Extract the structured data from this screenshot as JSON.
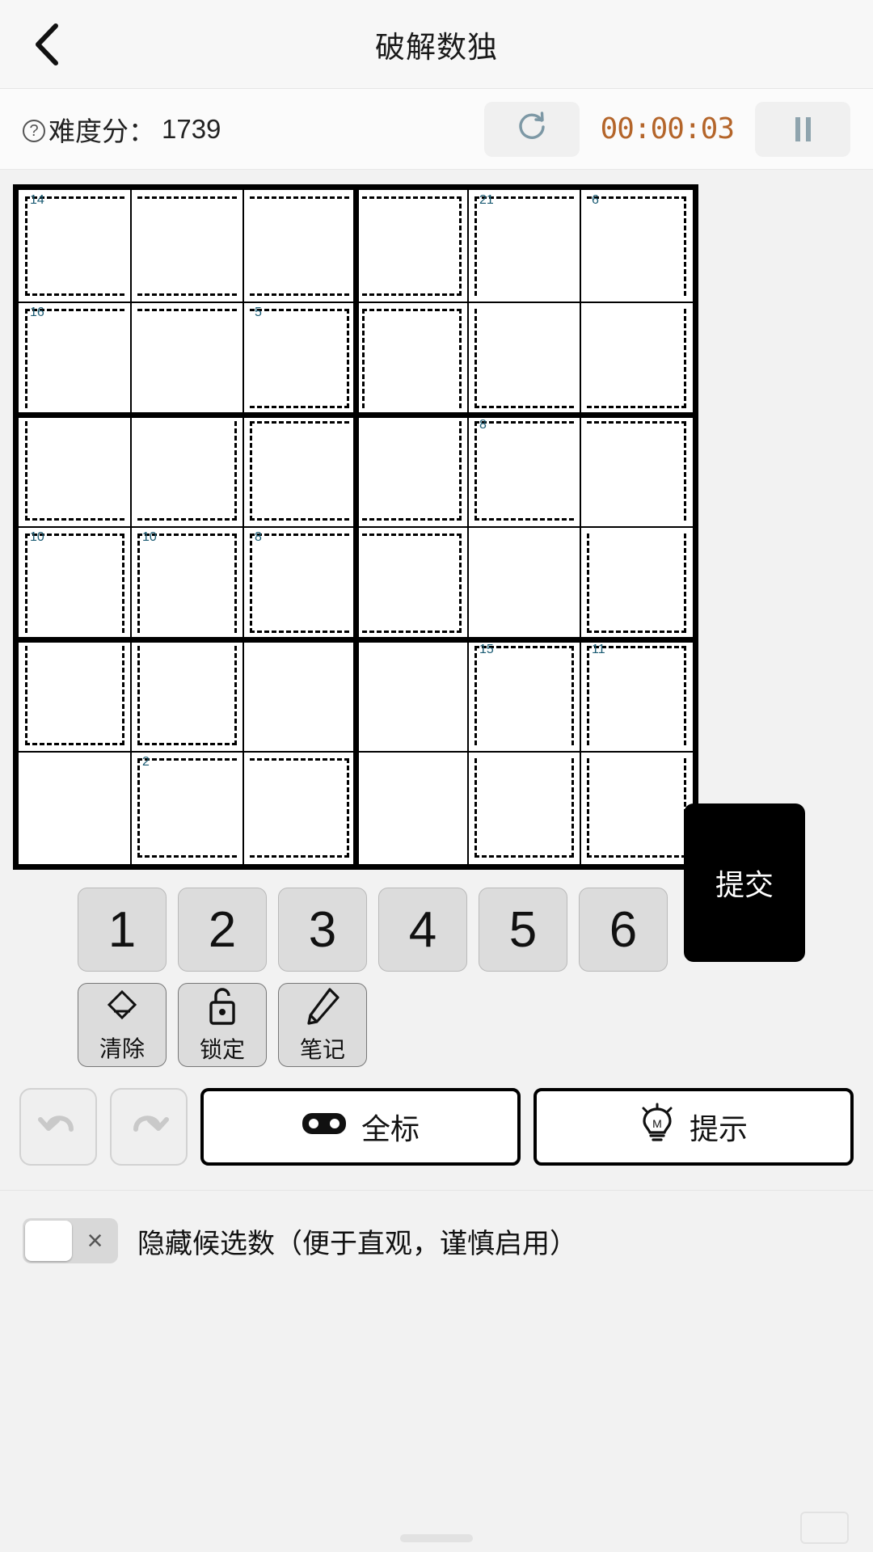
{
  "header": {
    "back_icon": "chevron-left-icon",
    "title": "破解数独"
  },
  "infobar": {
    "help_icon": "question-circle-icon",
    "difficulty_label": "难度分：",
    "difficulty_value": "1739",
    "refresh_icon": "refresh-icon",
    "timer": "00:00:03",
    "pause_icon": "pause-icon",
    "timer_color": "#b4652a"
  },
  "board": {
    "size": 6,
    "box_rows": 2,
    "box_cols": 3,
    "cage_sum_color": "#1a5b73",
    "cages": [
      {
        "sum": "14",
        "cells": [
          [
            0,
            0
          ],
          [
            0,
            1
          ],
          [
            0,
            2
          ],
          [
            0,
            3
          ]
        ]
      },
      {
        "sum": "21",
        "cells": [
          [
            0,
            4
          ],
          [
            0,
            5
          ],
          [
            1,
            5
          ],
          [
            1,
            4
          ]
        ]
      },
      {
        "sum": "6",
        "cells": [
          [
            0,
            5
          ]
        ]
      },
      {
        "sum": "16",
        "cells": [
          [
            1,
            0
          ],
          [
            1,
            1
          ],
          [
            1,
            2
          ],
          [
            2,
            0
          ],
          [
            2,
            1
          ]
        ]
      },
      {
        "sum": "5",
        "cells": [
          [
            1,
            2
          ],
          [
            1,
            3
          ],
          [
            2,
            2
          ],
          [
            2,
            3
          ]
        ]
      },
      {
        "sum": "8",
        "cells": [
          [
            2,
            4
          ],
          [
            2,
            5
          ],
          [
            3,
            5
          ]
        ]
      },
      {
        "sum": "10",
        "cells": [
          [
            3,
            0
          ],
          [
            4,
            0
          ]
        ]
      },
      {
        "sum": "10",
        "cells": [
          [
            3,
            1
          ],
          [
            4,
            1
          ]
        ]
      },
      {
        "sum": "8",
        "cells": [
          [
            3,
            2
          ],
          [
            3,
            3
          ]
        ]
      },
      {
        "sum": "15",
        "cells": [
          [
            4,
            4
          ],
          [
            5,
            4
          ]
        ]
      },
      {
        "sum": "11",
        "cells": [
          [
            4,
            5
          ],
          [
            5,
            5
          ]
        ]
      },
      {
        "sum": "2",
        "cells": [
          [
            5,
            1
          ],
          [
            5,
            2
          ]
        ]
      }
    ],
    "cage_labels": [
      {
        "sum": "14",
        "row": 0,
        "col": 0
      },
      {
        "sum": "21",
        "row": 0,
        "col": 4
      },
      {
        "sum": "6",
        "row": 0,
        "col": 5
      },
      {
        "sum": "16",
        "row": 1,
        "col": 0
      },
      {
        "sum": "5",
        "row": 1,
        "col": 2
      },
      {
        "sum": "8",
        "row": 2,
        "col": 4
      },
      {
        "sum": "10",
        "row": 3,
        "col": 0
      },
      {
        "sum": "10",
        "row": 3,
        "col": 1
      },
      {
        "sum": "8",
        "row": 3,
        "col": 2
      },
      {
        "sum": "15",
        "row": 4,
        "col": 4
      },
      {
        "sum": "11",
        "row": 4,
        "col": 5
      },
      {
        "sum": "2",
        "row": 5,
        "col": 1
      }
    ],
    "values": [
      [
        "",
        "",
        "",
        "",
        "",
        ""
      ],
      [
        "",
        "",
        "",
        "",
        "",
        ""
      ],
      [
        "",
        "",
        "",
        "",
        "",
        ""
      ],
      [
        "",
        "",
        "",
        "",
        "",
        ""
      ],
      [
        "",
        "",
        "",
        "",
        "",
        ""
      ],
      [
        "",
        "",
        "",
        "",
        "",
        ""
      ]
    ]
  },
  "keypad": {
    "numbers": [
      "1",
      "2",
      "3",
      "4",
      "5",
      "6"
    ],
    "tools": [
      {
        "label": "清除",
        "icon": "eraser-icon"
      },
      {
        "label": "锁定",
        "icon": "lock-open-icon"
      },
      {
        "label": "笔记",
        "icon": "pencil-icon"
      }
    ],
    "submit_label": "提交"
  },
  "actions": {
    "undo_icon": "undo-icon",
    "redo_icon": "redo-icon",
    "mark_all": {
      "label": "全标",
      "icon": "glasses-icon"
    },
    "hint": {
      "label": "提示",
      "icon": "lightbulb-icon"
    }
  },
  "toggle": {
    "state": "off",
    "off_mark": "×",
    "label": "隐藏候选数（便于直观，谨慎启用）"
  }
}
